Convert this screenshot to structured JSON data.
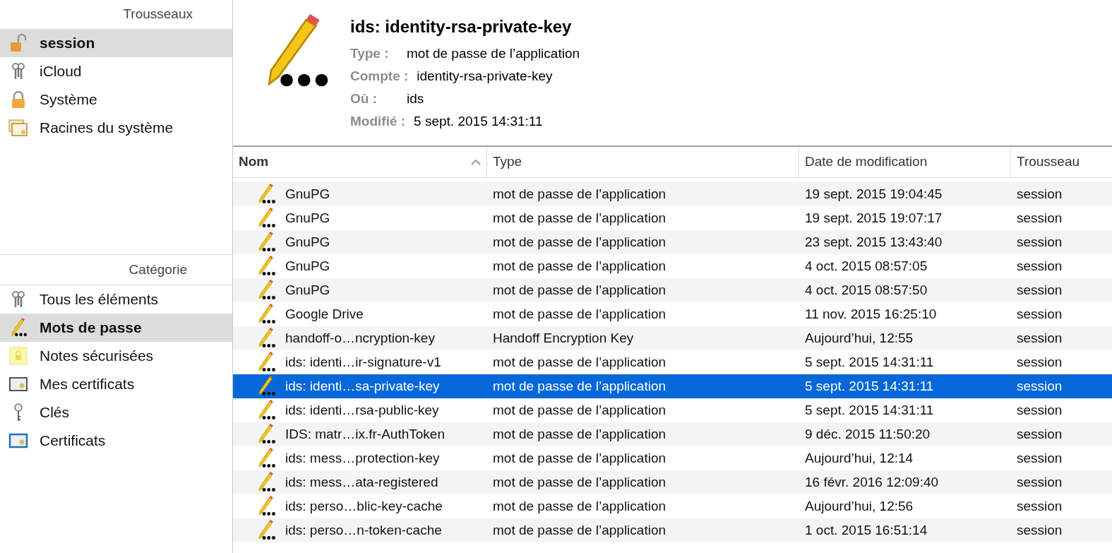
{
  "keychains": {
    "header": "Trousseaux",
    "items": [
      {
        "label": "session",
        "kind": "lock-open",
        "selected": true
      },
      {
        "label": "iCloud",
        "kind": "keys",
        "selected": false
      },
      {
        "label": "Système",
        "kind": "lock",
        "selected": false
      },
      {
        "label": "Racines du système",
        "kind": "certificates",
        "selected": false
      }
    ]
  },
  "categories": {
    "header": "Catégorie",
    "items": [
      {
        "label": "Tous les éléments",
        "kind": "keys",
        "selected": false
      },
      {
        "label": "Mots de passe",
        "kind": "password",
        "selected": true
      },
      {
        "label": "Notes sécurisées",
        "kind": "note",
        "selected": false
      },
      {
        "label": "Mes certificats",
        "kind": "certificate",
        "selected": false
      },
      {
        "label": "Clés",
        "kind": "key",
        "selected": false
      },
      {
        "label": "Certificats",
        "kind": "certificate-blue",
        "selected": false
      }
    ]
  },
  "detail": {
    "title": "ids: identity-rsa-private-key",
    "fields": [
      {
        "label": "Type :",
        "value": "mot de passe de l’application"
      },
      {
        "label": "Compte :",
        "value": "identity-rsa-private-key"
      },
      {
        "label": "Où :",
        "value": "ids"
      },
      {
        "label": "Modifié :",
        "value": "5 sept. 2015 14:31:11"
      }
    ]
  },
  "table": {
    "columns": [
      {
        "label": "Nom",
        "sorted": true
      },
      {
        "label": "Type",
        "sorted": false
      },
      {
        "label": "Date de modification",
        "sorted": false
      },
      {
        "label": "Trousseau",
        "sorted": false
      }
    ],
    "rows": [
      {
        "name": "GnuPG",
        "type": "mot de passe de l’application",
        "date": "19 sept. 2015 19:04:45",
        "keychain": "session",
        "selected": false
      },
      {
        "name": "GnuPG",
        "type": "mot de passe de l’application",
        "date": "19 sept. 2015 19:07:17",
        "keychain": "session",
        "selected": false
      },
      {
        "name": "GnuPG",
        "type": "mot de passe de l’application",
        "date": "23 sept. 2015 13:43:40",
        "keychain": "session",
        "selected": false
      },
      {
        "name": "GnuPG",
        "type": "mot de passe de l’application",
        "date": "4 oct. 2015 08:57:05",
        "keychain": "session",
        "selected": false
      },
      {
        "name": "GnuPG",
        "type": "mot de passe de l’application",
        "date": "4 oct. 2015 08:57:50",
        "keychain": "session",
        "selected": false
      },
      {
        "name": "Google Drive",
        "type": "mot de passe de l’application",
        "date": "11 nov. 2015 16:25:10",
        "keychain": "session",
        "selected": false
      },
      {
        "name": "handoff-o…ncryption-key",
        "type": "Handoff Encryption Key",
        "date": "Aujourd’hui, 12:55",
        "keychain": "session",
        "selected": false
      },
      {
        "name": "ids: identi…ir-signature-v1",
        "type": "mot de passe de l’application",
        "date": "5 sept. 2015 14:31:11",
        "keychain": "session",
        "selected": false
      },
      {
        "name": "ids: identi…sa-private-key",
        "type": "mot de passe de l’application",
        "date": "5 sept. 2015 14:31:11",
        "keychain": "session",
        "selected": true
      },
      {
        "name": "ids: identi…rsa-public-key",
        "type": "mot de passe de l’application",
        "date": "5 sept. 2015 14:31:11",
        "keychain": "session",
        "selected": false
      },
      {
        "name": "IDS: matr…ix.fr-AuthToken",
        "type": "mot de passe de l’application",
        "date": "9 déc. 2015 11:50:20",
        "keychain": "session",
        "selected": false
      },
      {
        "name": "ids: mess…protection-key",
        "type": "mot de passe de l’application",
        "date": "Aujourd’hui, 12:14",
        "keychain": "session",
        "selected": false
      },
      {
        "name": "ids: mess…ata-registered",
        "type": "mot de passe de l’application",
        "date": "16 févr. 2016 12:09:40",
        "keychain": "session",
        "selected": false
      },
      {
        "name": "ids: perso…blic-key-cache",
        "type": "mot de passe de l’application",
        "date": "Aujourd’hui, 12:56",
        "keychain": "session",
        "selected": false
      },
      {
        "name": "ids: perso…n-token-cache",
        "type": "mot de passe de l’application",
        "date": "1 oct. 2015 16:51:14",
        "keychain": "session",
        "selected": false
      }
    ]
  }
}
